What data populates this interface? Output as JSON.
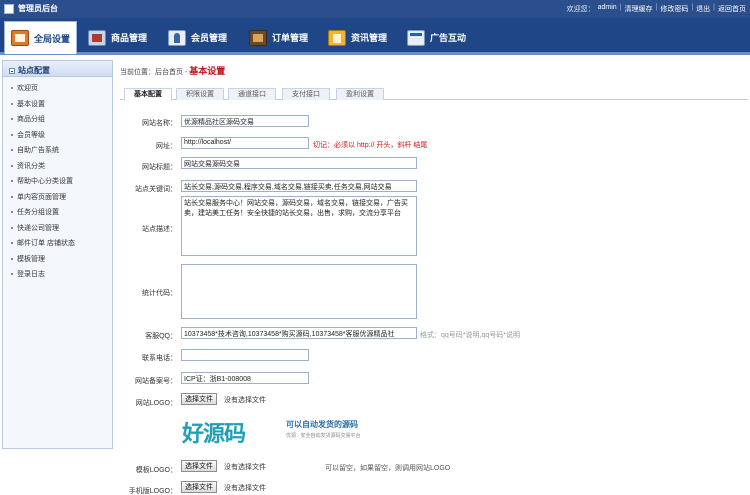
{
  "topbar": {
    "title": "管理员后台",
    "user": "欢迎您：",
    "user_name": "admin",
    "links": [
      "清理缓存",
      "修改密码",
      "退出",
      "返回首页"
    ]
  },
  "nav": [
    {
      "label": "全局设置",
      "icon": "home-icon",
      "active": true
    },
    {
      "label": "商品管理",
      "icon": "goods-icon"
    },
    {
      "label": "会员管理",
      "icon": "member-icon"
    },
    {
      "label": "订单管理",
      "icon": "order-icon"
    },
    {
      "label": "资讯管理",
      "icon": "news-icon"
    },
    {
      "label": "广告互动",
      "icon": "ad-icon"
    }
  ],
  "sidebar": {
    "title": "站点配置",
    "items": [
      "欢迎页",
      "基本设置",
      "商品分组",
      "会员等级",
      "自助广告系统",
      "资讯分类",
      "帮助中心分类设置",
      "单内容页面管理",
      "任务分组设置",
      "快递公司管理",
      "邮件订单 店铺状态",
      "模板管理",
      "登录日志"
    ]
  },
  "breadcrumb": {
    "prefix": "当前位置：后台首页 -",
    "current": "基本设置"
  },
  "tabs": [
    "基本配置",
    "积限设置",
    "通道接口",
    "支付接口",
    "盈利设置"
  ],
  "form": {
    "site_name_label": "网站名称：",
    "site_name_value": "优源精品社区源码交易",
    "url_label": "网址：",
    "url_value": "http://localhost/",
    "url_hint": "切记：必须以 http:// 开头，斜杆 结尾",
    "site_title_label": "网站标题：",
    "site_title_value": "网站交易源码交易",
    "keywords_label": "站点关键词：",
    "keywords_value": "站长交易,源码交易,程序交易,域名交易,链接买卖,任务交易,网站交易",
    "desc_label": "站点描述：",
    "desc_value": "站长交易服务中心！网站交易，源码交易，域名交易，链接交易，广告买卖，建站美工任务！安全快捷的站长交易，出售，求购，交流分享平台",
    "stats_label": "统计代码：",
    "stats_value": "",
    "qq_label": "客服QQ：",
    "qq_value": "10373458*技术咨询,10373458*购买源码,10373458*客服优源精品社",
    "qq_hint": "格式：qq号码*说明,qq号码*说明",
    "phone_label": "联系电话：",
    "phone_value": "",
    "icp_label": "网站备案号：",
    "icp_value": "ICP证：浙B1-008008",
    "logo_label": "网站LOGO：",
    "choose_file": "选择文件",
    "no_file": "没有选择文件",
    "logo_big": "好源码",
    "logo_slogan": "可以自动发货的源码",
    "logo_sub": "优源 · 安全自动发货源码交易平台",
    "tpl_logo_label": "模板LOGO：",
    "tpl_logo_hint": "可以留空，如果留空，则调用网站LOGO",
    "mobile_logo_label": "手机版LOGO："
  },
  "colors": {
    "topbar": "#2b4f8c",
    "nav": "#1f4787",
    "accent_red": "#c0141b"
  }
}
